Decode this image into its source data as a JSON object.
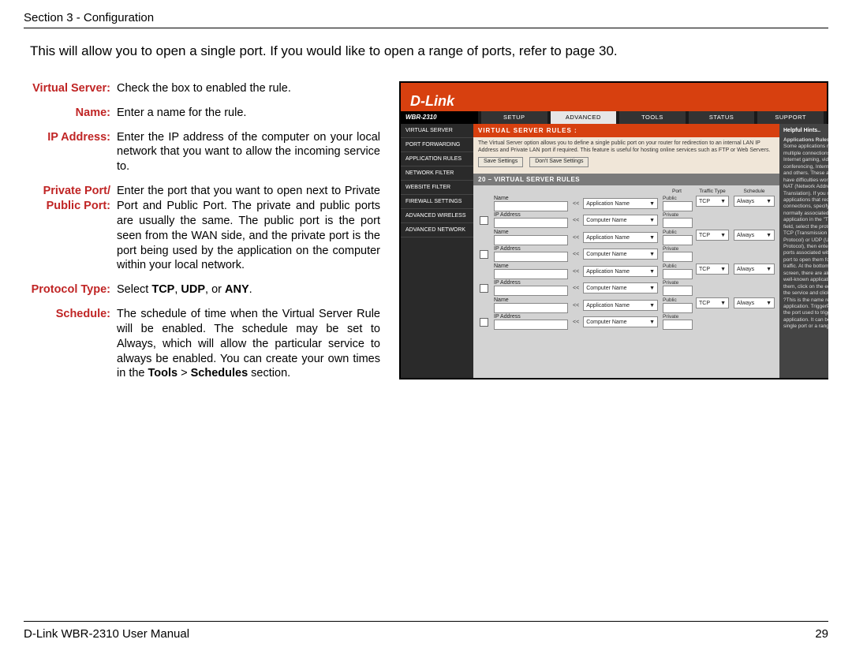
{
  "header": "Section 3 - Configuration",
  "intro": "This will allow you to open a single port. If you would like to open a range of ports, refer to page 30.",
  "definitions": [
    {
      "label": "Virtual Server:",
      "text": "Check the box to enabled the rule."
    },
    {
      "label": "Name:",
      "text": "Enter a name for the rule."
    },
    {
      "label": "IP Address:",
      "text": "Enter the IP address of the computer on your local network that you want to allow the incoming service to."
    },
    {
      "label": "Private Port/ Public Port:",
      "text": "Enter the port that you want to open next to Private Port and Public Port. The private and public ports are usually the same. The public port is the port seen from the WAN side, and the private port is the port being used by the application on the computer within your local network."
    },
    {
      "label": "Protocol Type:",
      "text_html": "Select <b>TCP</b>, <b>UDP</b>, or <b>ANY</b>."
    },
    {
      "label": "Schedule:",
      "text_html": "The schedule of time when the Virtual Server Rule will be enabled. The schedule may be set to Always, which will allow the particular service to always be enabled. You can create your own times in the <b>Tools</b> &gt; <b>Schedules</b> section."
    }
  ],
  "screenshot": {
    "brand": "D-Link",
    "model": "WBR-2310",
    "tabs": [
      "SETUP",
      "ADVANCED",
      "TOOLS",
      "STATUS",
      "SUPPORT"
    ],
    "active_tab": "ADVANCED",
    "sidebar": [
      "VIRTUAL SERVER",
      "PORT FORWARDING",
      "APPLICATION RULES",
      "NETWORK FILTER",
      "WEBSITE FILTER",
      "FIREWALL SETTINGS",
      "ADVANCED WIRELESS",
      "ADVANCED NETWORK"
    ],
    "rules_title": "VIRTUAL SERVER RULES :",
    "rules_desc": "The Virtual Server option allows you to define a single public port on your router for redirection to an internal LAN IP Address and Private LAN port if required. This feature is useful for hosting online services such as FTP or Web Servers.",
    "save_btn": "Save Settings",
    "dont_save_btn": "Don't Save Settings",
    "grid_title": "20 – VIRTUAL SERVER RULES",
    "col_port": "Port",
    "col_traffic": "Traffic Type",
    "col_schedule": "Schedule",
    "row_name": "Name",
    "row_ip": "IP Address",
    "row_public": "Public",
    "row_private": "Private",
    "sel_app": "Application Name",
    "sel_comp": "Computer Name",
    "sel_tcp": "TCP",
    "sel_always": "Always",
    "ll": "<<",
    "hints_title": "Helpful Hints..",
    "hints_sub": "Applications Rules :",
    "hints_body": "Some applications require multiple connections, such as Internet gaming, video conferencing, Internet telephony and others. These applications have difficulties working through NAT (Network Address Translation). If you need to run applications that require multiple connections, specify the port normally associated with an application in the \"TriggerPort\" field, select the protocol type as TCP (Transmission Control Protocol) or UDP (User Datagram Protocol), then enter the public ports associated with the trigger port to open them for inbound traffic. At the bottom of the screen, there are already defined well-known applications. To use them, click on the edit icon enable the service and click Apply. Name ?This is the name referencing the application. TriggerPort ?This is the port used to trigger the application. It can be either a single port or a range of ports."
  },
  "footer_left": "D-Link WBR-2310 User Manual",
  "footer_right": "29"
}
